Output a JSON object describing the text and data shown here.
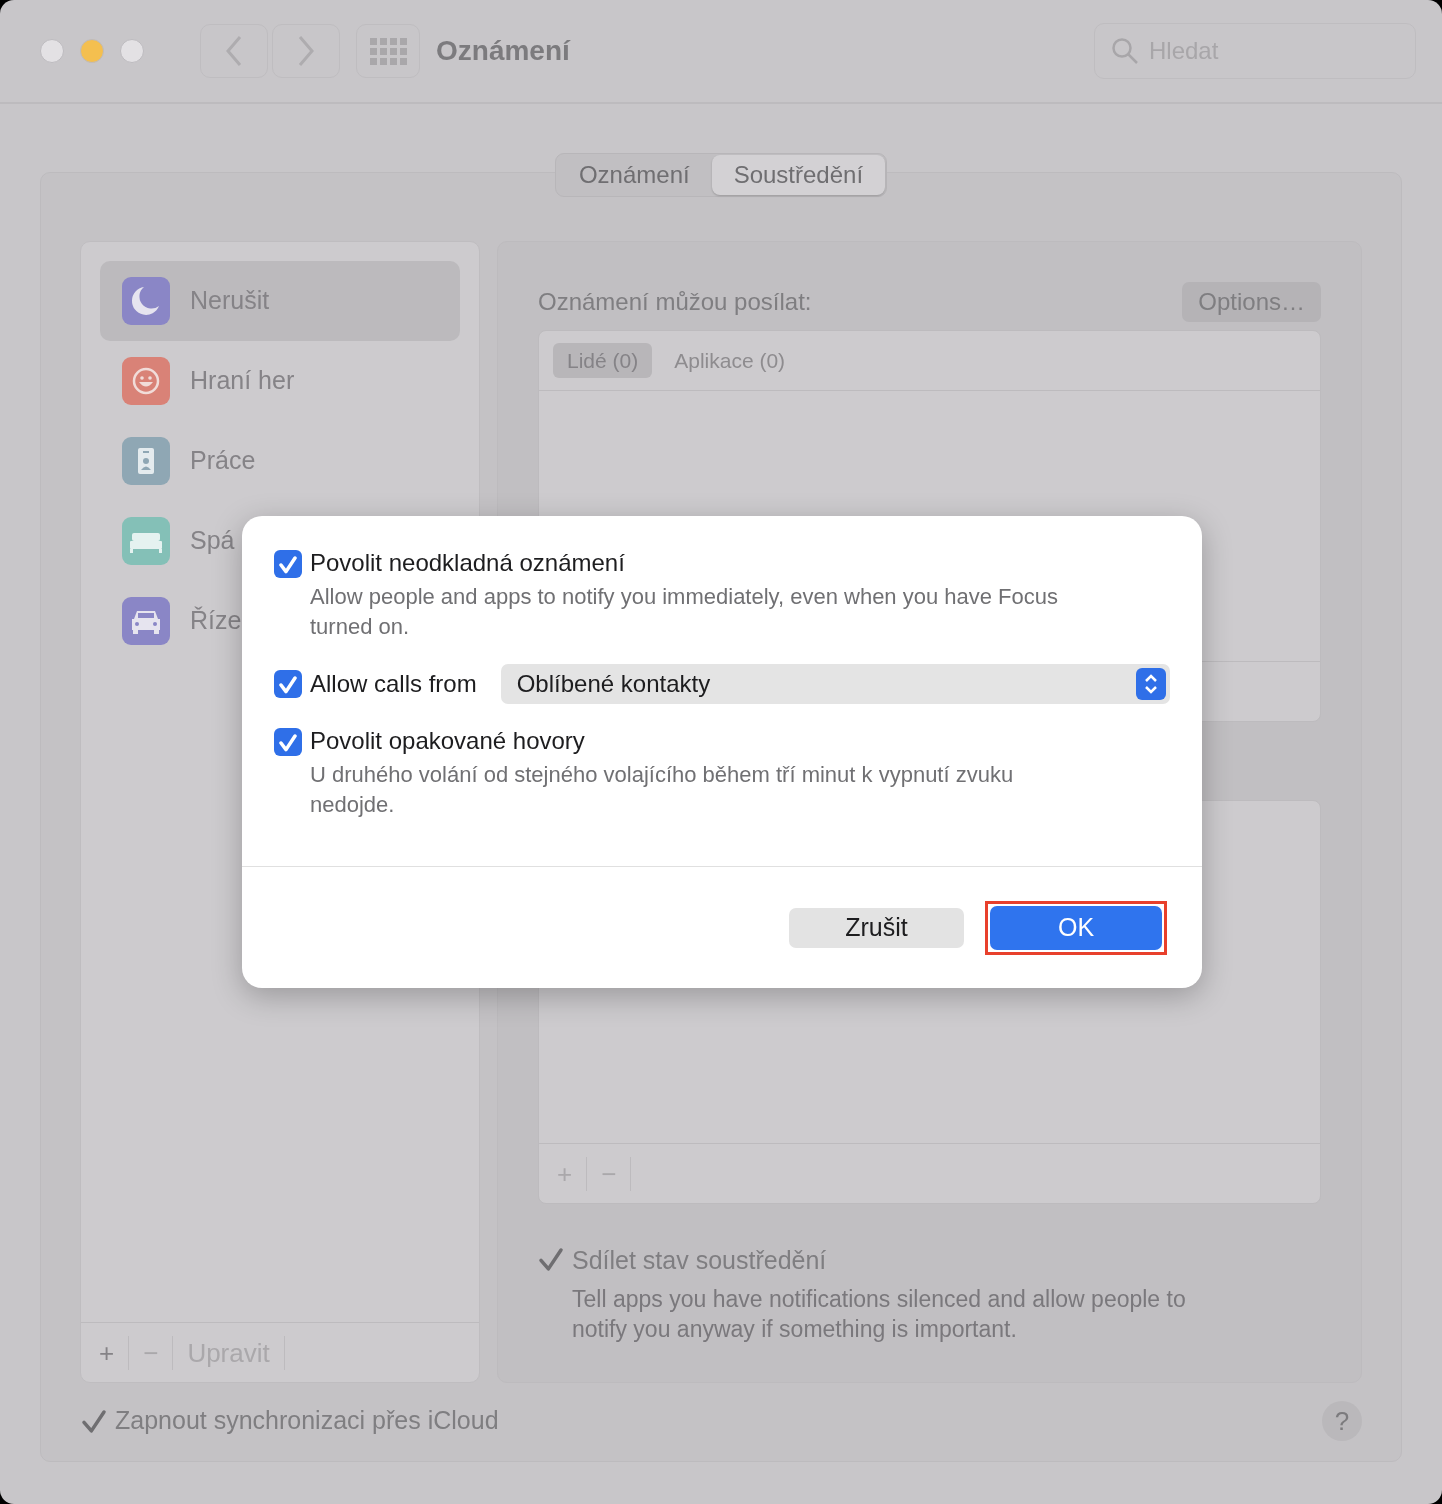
{
  "window": {
    "title": "Oznámení",
    "search": {
      "placeholder": "Hledat"
    }
  },
  "tabs": [
    {
      "label": "Oznámení",
      "selected": false
    },
    {
      "label": "Soustředění",
      "selected": true
    }
  ],
  "sidebar": {
    "items": [
      {
        "label": "Nerušit",
        "kind": "moon",
        "color": "#8a86c6",
        "selected": true
      },
      {
        "label": "Hraní her",
        "kind": "smiley",
        "color": "#d98277",
        "selected": false
      },
      {
        "label": "Práce",
        "kind": "badge",
        "color": "#8fa7b4",
        "selected": false
      },
      {
        "label": "Spá",
        "kind": "bed",
        "color": "#84c0b7",
        "selected": false
      },
      {
        "label": "Říze",
        "kind": "car",
        "color": "#8a86c6",
        "selected": false
      }
    ],
    "toolbar": [
      {
        "label": "+",
        "disabled": false
      },
      {
        "label": "−",
        "disabled": true
      },
      {
        "label": "Upravit",
        "disabled": true
      }
    ]
  },
  "detail": {
    "heading": "Oznámení můžou posílat:",
    "options_button": "Options…",
    "subtabs": [
      {
        "label": "Lidé (0)",
        "selected": true
      },
      {
        "label": "Aplikace (0)",
        "selected": false
      }
    ],
    "list_toolbar": [
      {
        "label": "+",
        "disabled": true
      },
      {
        "label": "−",
        "disabled": true
      }
    ],
    "share": {
      "label": "Sdílet stav soustředění",
      "description": "Tell apps you have notifications silenced and allow people to notify you anyway if something is important.",
      "checked": true
    }
  },
  "icloud": {
    "label": "Zapnout synchronizaci přes iCloud",
    "checked": true
  },
  "help": "?",
  "dialog": {
    "options": [
      {
        "kind": "checkbox",
        "label": "Povolit neodkladná oznámení",
        "checked": true,
        "description": "Allow people and apps to notify you immediately, even when you have Focus turned on."
      },
      {
        "kind": "select",
        "label": "Allow calls from",
        "checked": true,
        "value": "Oblíbené kontakty"
      },
      {
        "kind": "checkbox",
        "label": "Povolit opakované hovory",
        "checked": true,
        "description": "U druhého volání od stejného volajícího během tří minut k vypnutí zvuku nedojde."
      }
    ],
    "buttons": [
      {
        "label": "Zrušit",
        "kind": "secondary",
        "highlighted": false
      },
      {
        "label": "OK",
        "kind": "primary",
        "highlighted": true
      }
    ]
  }
}
